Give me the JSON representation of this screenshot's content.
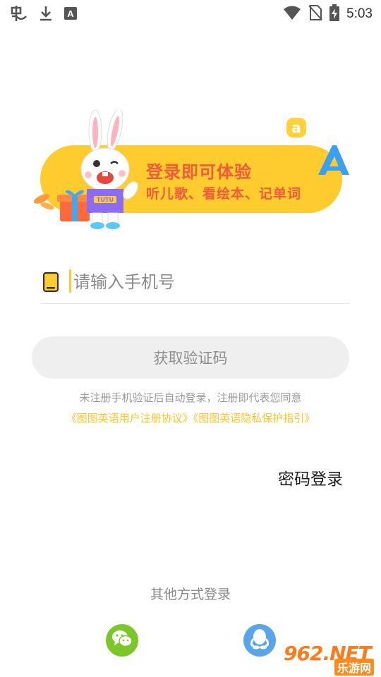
{
  "status_bar": {
    "time": "5:03",
    "left_icons": [
      "app-notification-icon",
      "download-icon",
      "font-icon"
    ],
    "right_icons": [
      "wifi-icon",
      "no-sim-icon",
      "battery-charging-icon"
    ]
  },
  "banner": {
    "title": "登录即可体验",
    "subtitle": "听儿歌、看绘本、记单词",
    "mascot_shirt": "TUTU",
    "deco_letters": [
      "a",
      "A"
    ]
  },
  "login": {
    "phone_placeholder": "请输入手机号",
    "get_code_label": "获取验证码",
    "agreement_text": "未注册手机验证后自动登录，注册即代表您同意",
    "user_agreement_link": "《图图英语用户注册协议》",
    "privacy_link": "《图图英语隐私保护指引》",
    "password_login_label": "密码登录"
  },
  "other_login": {
    "title": "其他方式登录",
    "methods": [
      "wechat-icon",
      "qq-icon"
    ]
  },
  "watermark": {
    "main": "962.NET",
    "sub": "乐游网"
  },
  "colors": {
    "accent_yellow": "#ffcc2f",
    "banner_text": "#f15b3c",
    "link_yellow": "#ffc42a",
    "wechat_green": "#7bc72a",
    "qq_blue": "#5aa4e8"
  }
}
